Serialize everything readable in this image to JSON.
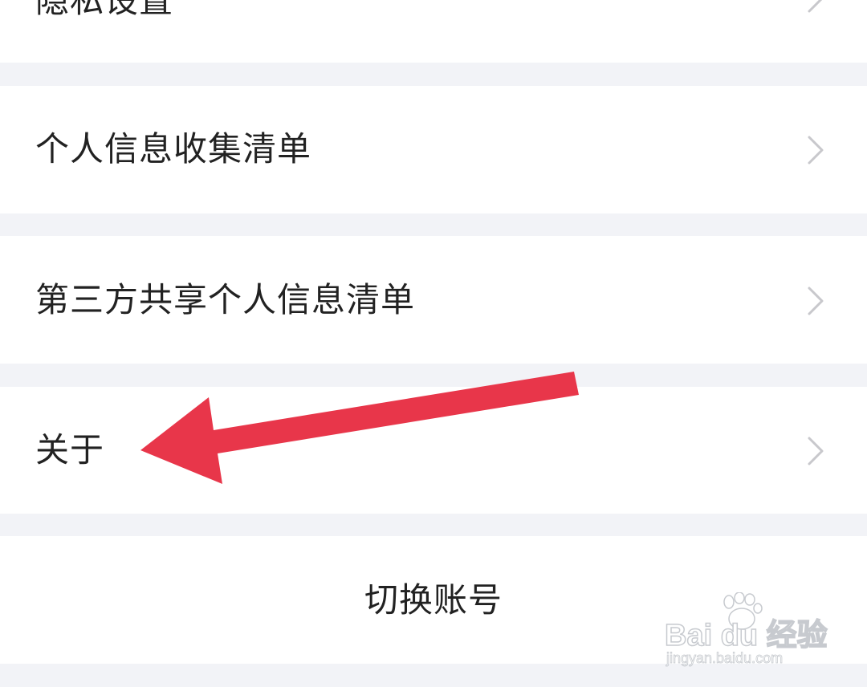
{
  "settings": {
    "items": [
      {
        "label": "隐私设置"
      },
      {
        "label": "个人信息收集清单"
      },
      {
        "label": "第三方共享个人信息清单"
      },
      {
        "label": "关于"
      }
    ],
    "switch_account_label": "切换账号"
  },
  "annotation": {
    "arrow_color": "#e8364a",
    "points_to": "关于"
  },
  "watermark": {
    "brand_text": "Bai du 经验",
    "url_text": "jingyan.baidu.com"
  },
  "colors": {
    "background": "#f2f3f7",
    "row": "#ffffff",
    "text": "#222222",
    "chevron": "#c8c8cc",
    "arrow": "#e8364a"
  }
}
